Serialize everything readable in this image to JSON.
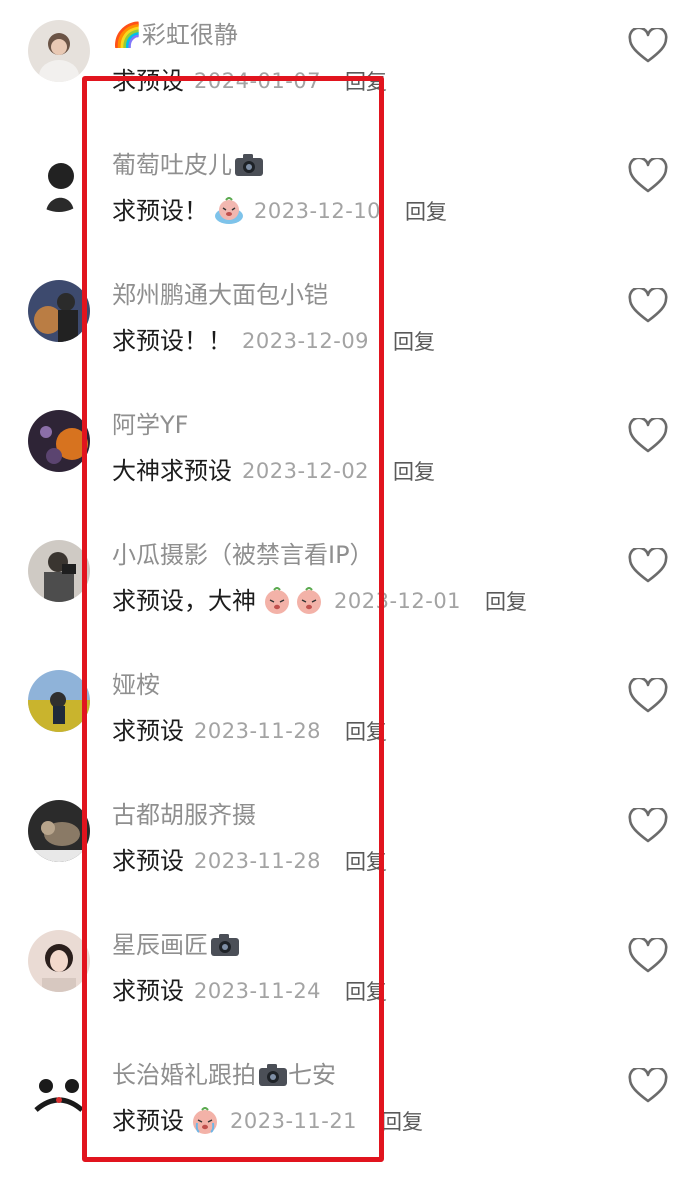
{
  "comments": [
    {
      "username": "🌈彩虹很静",
      "text": "求预设",
      "emoji_count": 0,
      "date": "2024-01-07",
      "reply": "回复",
      "avatar_color": "#d9d3cc"
    },
    {
      "username": "葡萄吐皮儿",
      "username_camera": true,
      "text": "求预设！",
      "emoji_count": 1,
      "date": "2023-12-10",
      "reply": "回复",
      "avatar_color": "#f0f0f0"
    },
    {
      "username": "郑州鹏通大面包小铠",
      "text": "求预设！！",
      "emoji_count": 0,
      "date": "2023-12-09",
      "reply": "回复",
      "avatar_color": "#4a4e6a"
    },
    {
      "username": "阿学YF",
      "text": "大神求预设",
      "emoji_count": 0,
      "date": "2023-12-02",
      "reply": "回复",
      "avatar_color": "#3b2a3a"
    },
    {
      "username": "小瓜摄影（被禁言看IP）",
      "text": "求预设，大神",
      "emoji_count": 2,
      "date": "2023-12-01",
      "reply": "回复",
      "avatar_color": "#5c5a58"
    },
    {
      "username": "娅桉",
      "text": "求预设",
      "emoji_count": 0,
      "date": "2023-11-28",
      "reply": "回复",
      "avatar_color": "#c9b24a"
    },
    {
      "username": "古都胡服齐摄",
      "text": "求预设",
      "emoji_count": 0,
      "date": "2023-11-28",
      "reply": "回复",
      "avatar_color": "#3d3d3d"
    },
    {
      "username": "星辰画匠",
      "username_camera": true,
      "text": "求预设",
      "emoji_count": 0,
      "date": "2023-11-24",
      "reply": "回复",
      "avatar_color": "#e9d6cf"
    },
    {
      "username": "长治婚礼跟拍",
      "username_camera": true,
      "username_suffix": "七安",
      "text": "求预设",
      "emoji_count": 1,
      "date": "2023-11-21",
      "reply": "回复",
      "avatar_color": "#f4f4f4"
    }
  ],
  "colors": {
    "highlight_border": "#e1141e",
    "username": "#8f8f8f",
    "comment_text": "#1c1c1c",
    "date": "#a3a3a3",
    "reply": "#5a5a5a",
    "heart_stroke": "#6b6b6b"
  },
  "icons": {
    "like": "heart-outline-icon",
    "camera": "camera-emoji-icon",
    "sticker": "crying-peach-sticker-icon"
  }
}
